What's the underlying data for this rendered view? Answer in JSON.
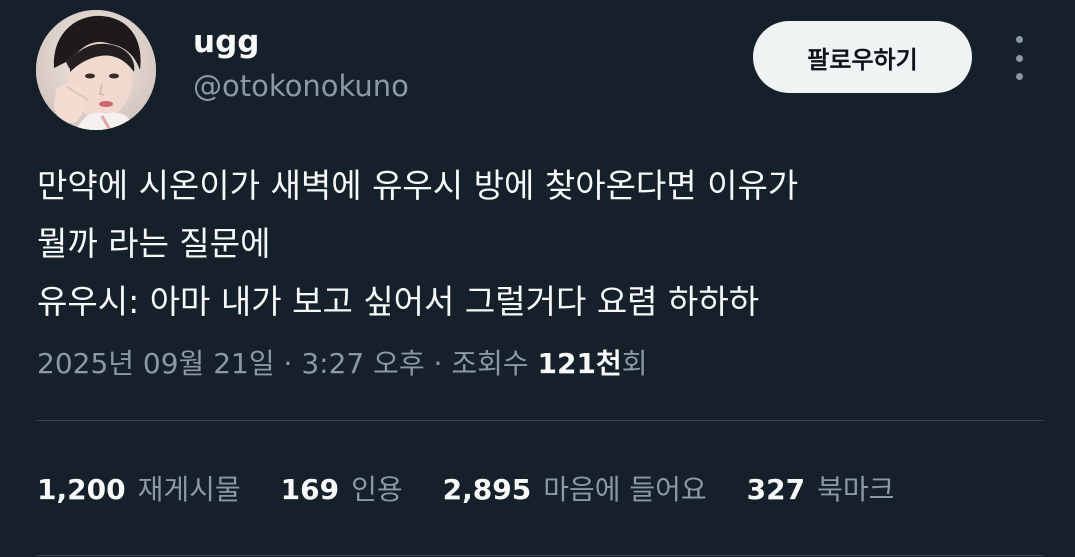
{
  "user": {
    "display_name": "ugg",
    "handle": "@otokonokuno"
  },
  "actions": {
    "follow_label": "팔로우하기",
    "more_icon": "more-vertical-icon"
  },
  "tweet": {
    "lines": [
      "만약에 시온이가 새벽에 유우시 방에 찾아온다면 이유가",
      "뭘까 라는 질문에",
      "유우시: 아마 내가 보고 싶어서 그럴거다 요렴 하하하"
    ]
  },
  "meta": {
    "date": "2025년 09월 21일",
    "time": "3:27 오후",
    "views_label": "조회수",
    "views_count": "121천",
    "views_suffix": "회"
  },
  "stats": [
    {
      "value": "1,200",
      "label": "재게시물"
    },
    {
      "value": "169",
      "label": "인용"
    },
    {
      "value": "2,895",
      "label": "마음에 들어요"
    },
    {
      "value": "327",
      "label": "북마크"
    }
  ],
  "colors": {
    "background": "#15202b",
    "text": "#f7f9f9",
    "secondary": "#8b98a5",
    "button_bg": "#eff3f4"
  }
}
